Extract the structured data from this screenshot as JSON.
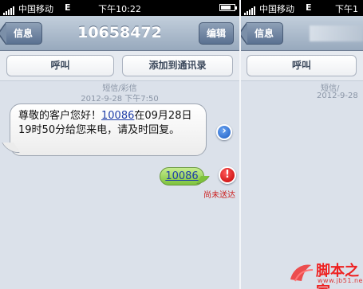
{
  "status_bar": {
    "carrier": "中国移动",
    "network": "E",
    "time": "下午10:22",
    "time_partial": "下午1"
  },
  "conversation": {
    "back_label": "信息",
    "title": "10658472",
    "edit_label": "编辑"
  },
  "actions": {
    "call_label": "呼叫",
    "add_contact_label": "添加到通讯录"
  },
  "message_meta": {
    "type": "短信/彩信",
    "timestamp": "2012-9-28 下午7:50",
    "timestamp_partial": "2012-9-28"
  },
  "incoming_message": {
    "text_before": "尊敬的客户您好！",
    "link": "10086",
    "text_after": "在09月28日19时50分给您来电，请及时回复。"
  },
  "outgoing_message": {
    "text": "10086",
    "status": "尚未送达"
  },
  "watermark": {
    "brand": "脚本之家",
    "url": "www.jb51.net"
  },
  "colors": {
    "incoming_bubble": "#ffffff",
    "outgoing_bubble": "#8fcf4f",
    "error_red": "#cc0000",
    "nav_bar": "#a9b8ca"
  },
  "icons": {
    "detail": "chevron-right-circle-icon",
    "error": "exclamation-circle-icon"
  }
}
